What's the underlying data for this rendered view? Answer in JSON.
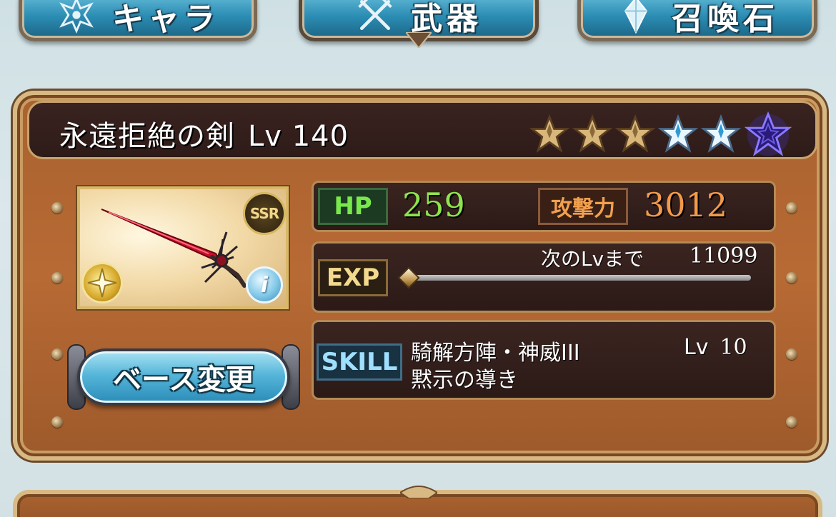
{
  "tabs": [
    {
      "label": "キャラ",
      "icon": "emblem-icon",
      "active": false
    },
    {
      "label": "武器",
      "icon": "crossed-swords-icon",
      "active": true
    },
    {
      "label": "召喚石",
      "icon": "crystal-icon",
      "active": false
    }
  ],
  "weapon": {
    "name": "永遠拒絶の剣",
    "level_label": "Lv",
    "level": "140",
    "rarity": "SSR",
    "uncap_stars": {
      "filled": 3,
      "blue": 2,
      "transcendence": 1
    }
  },
  "stats": {
    "hp_label": "HP",
    "hp": "259",
    "atk_label": "攻撃力",
    "atk": "3012",
    "exp_label": "EXP",
    "next_level_label": "次のLvまで",
    "next_level_exp": "11099",
    "exp_progress": 0.0
  },
  "skill": {
    "label": "SKILL",
    "name_line1": "騎解方陣・神威III",
    "name_line2": "黙示の導き",
    "level_label": "Lv",
    "level": "10"
  },
  "buttons": {
    "change_base": "ベース変更"
  },
  "colors": {
    "panel": "#b86a34",
    "hp_value": "#8ee44d",
    "atk_value": "#f39a4a",
    "tab_blue": "#2c8db4"
  }
}
